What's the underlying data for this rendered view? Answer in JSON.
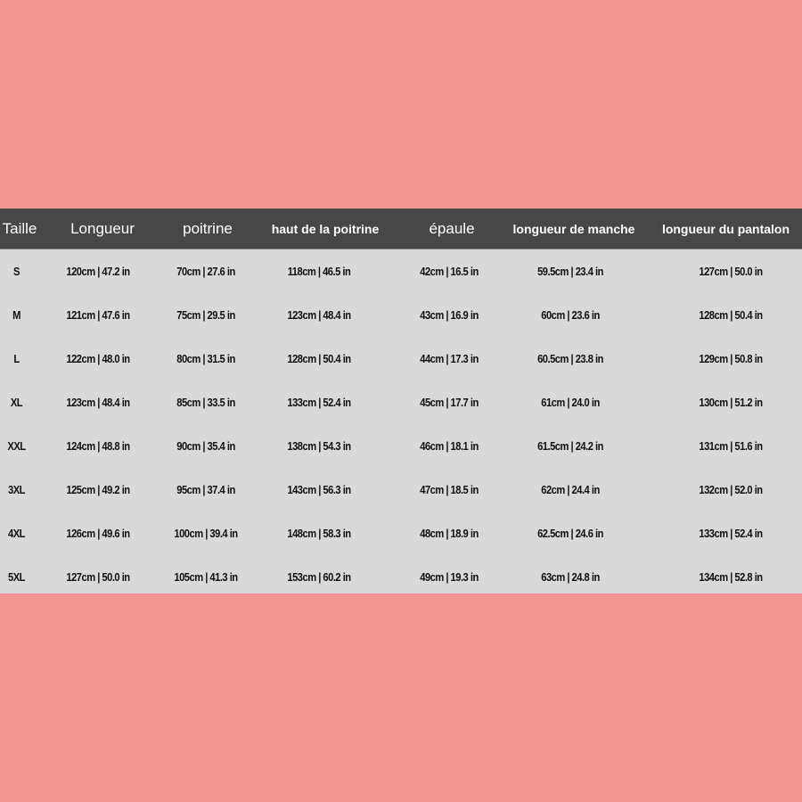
{
  "table": {
    "headers": [
      "Taille",
      "Longueur",
      "poitrine",
      "haut de la poitrine",
      "épaule",
      "longueur de manche",
      "longueur du pantalon"
    ],
    "rows": [
      [
        "S",
        "120cm | 47.2 in",
        "70cm | 27.6 in",
        "118cm | 46.5 in",
        "42cm | 16.5 in",
        "59.5cm | 23.4 in",
        "127cm | 50.0 in"
      ],
      [
        "M",
        "121cm | 47.6 in",
        "75cm | 29.5 in",
        "123cm | 48.4 in",
        "43cm | 16.9 in",
        "60cm | 23.6 in",
        "128cm | 50.4 in"
      ],
      [
        "L",
        "122cm | 48.0 in",
        "80cm | 31.5 in",
        "128cm | 50.4 in",
        "44cm | 17.3 in",
        "60.5cm | 23.8 in",
        "129cm | 50.8 in"
      ],
      [
        "XL",
        "123cm | 48.4 in",
        "85cm | 33.5 in",
        "133cm | 52.4 in",
        "45cm | 17.7 in",
        "61cm | 24.0 in",
        "130cm | 51.2 in"
      ],
      [
        "XXL",
        "124cm | 48.8 in",
        "90cm | 35.4 in",
        "138cm | 54.3 in",
        "46cm | 18.1 in",
        "61.5cm | 24.2 in",
        "131cm | 51.6 in"
      ],
      [
        "3XL",
        "125cm | 49.2 in",
        "95cm | 37.4 in",
        "143cm | 56.3 in",
        "47cm | 18.5 in",
        "62cm | 24.4 in",
        "132cm | 52.0 in"
      ],
      [
        "4XL",
        "126cm | 49.6 in",
        "100cm | 39.4 in",
        "148cm | 58.3 in",
        "48cm | 18.9 in",
        "62.5cm | 24.6 in",
        "133cm | 52.4 in"
      ],
      [
        "5XL",
        "127cm | 50.0 in",
        "105cm | 41.3 in",
        "153cm | 60.2 in",
        "49cm | 19.3 in",
        "63cm | 24.8 in",
        "134cm | 52.8 in"
      ]
    ]
  },
  "colors": {
    "background": "#f49594",
    "header_bg": "#474747",
    "header_text": "#ffffff",
    "body_bg": "#d9d9d9",
    "body_text": "#111111"
  }
}
